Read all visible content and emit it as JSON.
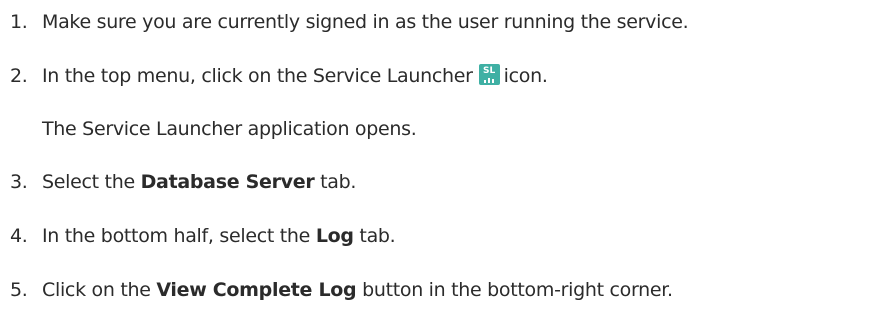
{
  "steps": [
    {
      "number": "1.",
      "text": "Make sure you are currently signed in as the user running the service."
    },
    {
      "number": "2.",
      "before": "In the top menu, click on the Service Launcher",
      "after": "icon."
    },
    {
      "note": "The Service Launcher application opens."
    },
    {
      "number": "3.",
      "before": "Select the ",
      "bold": "Database Server",
      "after": " tab."
    },
    {
      "number": "4.",
      "before": "In the bottom half, select the ",
      "bold": "Log",
      "after": " tab."
    },
    {
      "number": "5.",
      "before": "Click on the ",
      "bold": "View Complete Log",
      "after": " button in the bottom-right corner."
    }
  ],
  "icons": {
    "service_launcher": {
      "name": "service-launcher-icon",
      "label": "SL",
      "color": "#3fb0a4"
    }
  }
}
